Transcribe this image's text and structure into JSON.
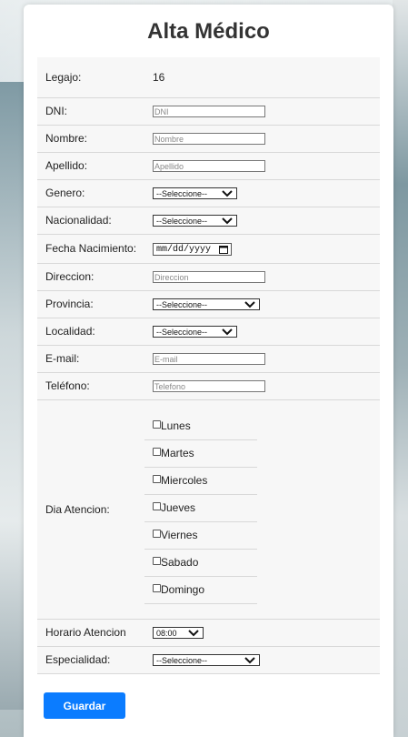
{
  "page": {
    "title": "Alta Médico"
  },
  "form": {
    "legajo": {
      "label": "Legajo:",
      "value": "16"
    },
    "dni": {
      "label": "DNI:",
      "placeholder": "DNI"
    },
    "nombre": {
      "label": "Nombre:",
      "placeholder": "Nombre"
    },
    "apellido": {
      "label": "Apellido:",
      "placeholder": "Apellido"
    },
    "genero": {
      "label": "Genero:",
      "selected": "--Seleccione--"
    },
    "nacionalidad": {
      "label": "Nacionalidad:",
      "selected": "--Seleccione--"
    },
    "fecha_nacimiento": {
      "label": "Fecha Nacimiento:",
      "value": "mm/dd/yyyy"
    },
    "direccion": {
      "label": "Direccion:",
      "placeholder": "Direccion"
    },
    "provincia": {
      "label": "Provincia:",
      "selected": "--Seleccione--"
    },
    "localidad": {
      "label": "Localidad:",
      "selected": "--Seleccione--"
    },
    "email": {
      "label": "E-mail:",
      "placeholder": "E-mail"
    },
    "telefono": {
      "label": "Teléfono:",
      "placeholder": "Telefono"
    },
    "dia_atencion": {
      "label": "Dia Atencion:",
      "days": [
        "Lunes",
        "Martes",
        "Miercoles",
        "Jueves",
        "Viernes",
        "Sabado",
        "Domingo"
      ]
    },
    "horario_atencion": {
      "label": "Horario Atencion",
      "selected": "08:00"
    },
    "especialidad": {
      "label": "Especialidad:",
      "selected": "--Seleccione--"
    }
  },
  "actions": {
    "save_label": "Guardar"
  },
  "colors": {
    "primary_button": "#0b7cff"
  }
}
